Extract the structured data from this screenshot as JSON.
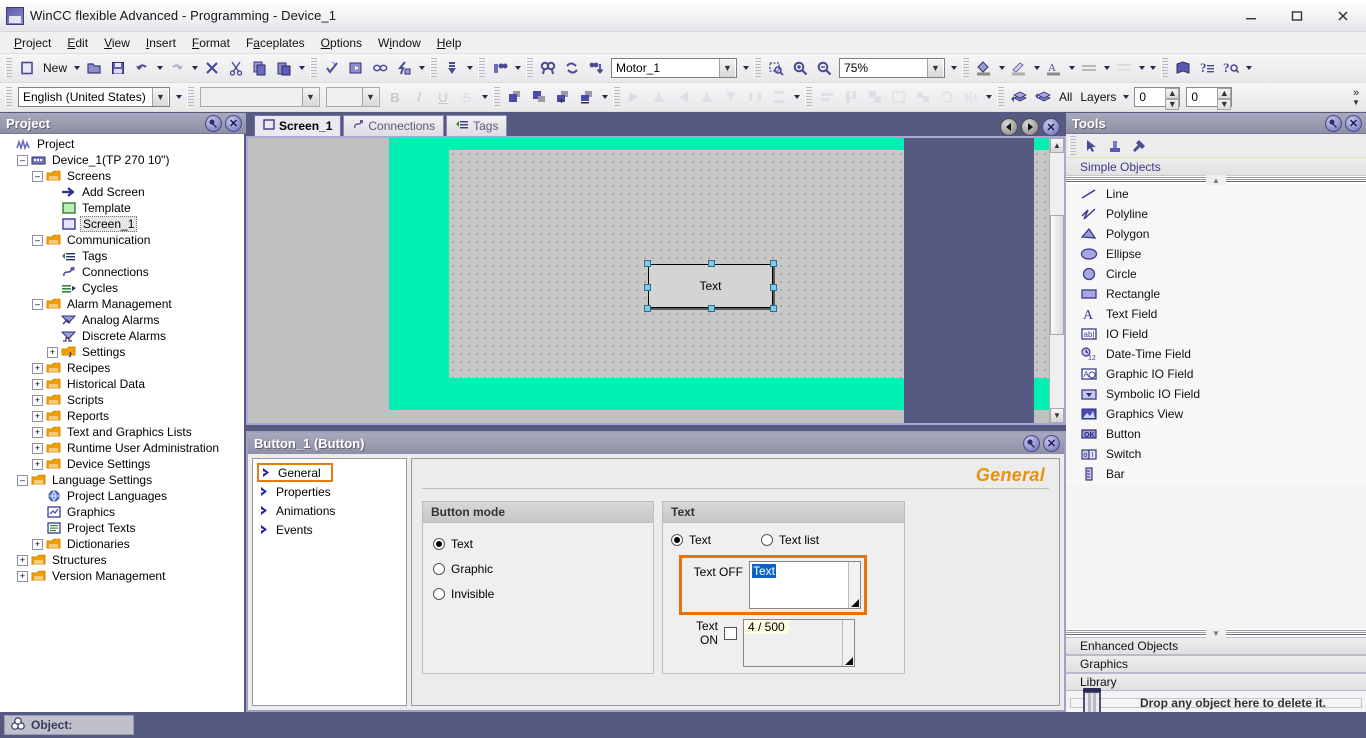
{
  "window": {
    "title": "WinCC flexible Advanced - Programming - Device_1",
    "minimize": "minimize-icon",
    "maximize": "maximize-icon",
    "close": "close-icon"
  },
  "menu": {
    "items": [
      "Project",
      "Edit",
      "View",
      "Insert",
      "Format",
      "Faceplates",
      "Options",
      "Window",
      "Help"
    ]
  },
  "toolbar1": {
    "new_label": "New",
    "tag_combo_value": "Motor_1",
    "zoom_value": "75%",
    "buttons": [
      "new-icon",
      "new-dropdown",
      "open-icon",
      "save-icon",
      "undo-icon",
      "undo-dropdown",
      "redo-icon",
      "redo-dropdown",
      "delete-icon",
      "cut-icon",
      "copy-icon",
      "paste-icon",
      "paste-dropdown",
      "check-consistency-icon",
      "generate-icon",
      "simulate-icon",
      "transfer-icon",
      "transfer-dropdown",
      "download-icon",
      "download-dropdown",
      "compare-icon",
      "compare-dropdown",
      "find-icon",
      "refresh-icon",
      "sort-icon",
      "fill-color-icon",
      "line-color-icon",
      "font-color-icon",
      "line-style-icon",
      "fill-style-icon",
      "help-book-icon",
      "help-topic-icon",
      "help-search-icon"
    ]
  },
  "toolbar2": {
    "language_value": "English (United States)",
    "font_value": "",
    "font_size_value": "",
    "bold_label": "B",
    "italic_label": "I",
    "underline_label": "U",
    "strikethrough_label": "S",
    "layers_all_label": "All",
    "layers_label": "Layers",
    "layer_value_1": "0",
    "layer_value_2": "0",
    "overflow_label": "»"
  },
  "project_panel": {
    "title": "Project",
    "pin_icon": "pin-icon",
    "close_icon": "close-icon",
    "tree": [
      {
        "label": "Project",
        "depth": 0,
        "expander": "",
        "icon": "project-icon"
      },
      {
        "label": "Device_1(TP 270 10\")",
        "depth": 1,
        "expander": "-",
        "icon": "device-icon"
      },
      {
        "label": "Screens",
        "depth": 2,
        "expander": "-",
        "icon": "folder-screens-icon"
      },
      {
        "label": "Add Screen",
        "depth": 3,
        "expander": "",
        "icon": "add-screen-icon"
      },
      {
        "label": "Template",
        "depth": 3,
        "expander": "",
        "icon": "template-icon"
      },
      {
        "label": "Screen_1",
        "depth": 3,
        "expander": "",
        "icon": "screen-icon",
        "selected": true
      },
      {
        "label": "Communication",
        "depth": 2,
        "expander": "-",
        "icon": "folder-comm-icon"
      },
      {
        "label": "Tags",
        "depth": 3,
        "expander": "",
        "icon": "tags-icon"
      },
      {
        "label": "Connections",
        "depth": 3,
        "expander": "",
        "icon": "connections-icon"
      },
      {
        "label": "Cycles",
        "depth": 3,
        "expander": "",
        "icon": "cycles-icon"
      },
      {
        "label": "Alarm Management",
        "depth": 2,
        "expander": "-",
        "icon": "folder-alarm-icon"
      },
      {
        "label": "Analog Alarms",
        "depth": 3,
        "expander": "",
        "icon": "analog-alarms-icon"
      },
      {
        "label": "Discrete Alarms",
        "depth": 3,
        "expander": "",
        "icon": "discrete-alarms-icon"
      },
      {
        "label": "Settings",
        "depth": 3,
        "expander": "+",
        "icon": "settings-icon"
      },
      {
        "label": "Recipes",
        "depth": 2,
        "expander": "+",
        "icon": "folder-recipes-icon"
      },
      {
        "label": "Historical Data",
        "depth": 2,
        "expander": "+",
        "icon": "folder-history-icon"
      },
      {
        "label": "Scripts",
        "depth": 2,
        "expander": "+",
        "icon": "folder-scripts-icon"
      },
      {
        "label": "Reports",
        "depth": 2,
        "expander": "+",
        "icon": "folder-reports-icon"
      },
      {
        "label": "Text and Graphics Lists",
        "depth": 2,
        "expander": "+",
        "icon": "folder-textlists-icon"
      },
      {
        "label": "Runtime User Administration",
        "depth": 2,
        "expander": "+",
        "icon": "folder-users-icon"
      },
      {
        "label": "Device Settings",
        "depth": 2,
        "expander": "+",
        "icon": "folder-devsettings-icon"
      },
      {
        "label": "Language Settings",
        "depth": 1,
        "expander": "-",
        "icon": "folder-lang-icon"
      },
      {
        "label": "Project Languages",
        "depth": 2,
        "expander": "",
        "icon": "globe-icon"
      },
      {
        "label": "Graphics",
        "depth": 2,
        "expander": "",
        "icon": "graphics-icon"
      },
      {
        "label": "Project Texts",
        "depth": 2,
        "expander": "",
        "icon": "texts-icon"
      },
      {
        "label": "Dictionaries",
        "depth": 2,
        "expander": "+",
        "icon": "folder-dict-icon"
      },
      {
        "label": "Structures",
        "depth": 1,
        "expander": "+",
        "icon": "folder-struct-icon"
      },
      {
        "label": "Version Management",
        "depth": 1,
        "expander": "+",
        "icon": "folder-version-icon"
      }
    ]
  },
  "editor": {
    "tabs": [
      {
        "label": "Screen_1",
        "icon": "screen-icon",
        "active": true
      },
      {
        "label": "Connections",
        "icon": "connections-icon",
        "active": false
      },
      {
        "label": "Tags",
        "icon": "tags-icon",
        "active": false
      }
    ],
    "nav_prev": "prev-icon",
    "nav_next": "next-icon",
    "nav_close": "close-icon",
    "object_text": "Text",
    "hmi_background_color": "#00f0b4",
    "grid_color": "#c8c8c8",
    "handle_color": "#7ecbe8"
  },
  "properties": {
    "title": "Button_1 (Button)",
    "pin_icon": "pin-icon",
    "close_icon": "close-icon",
    "section_header": "General",
    "nav": [
      {
        "label": "General",
        "active": true
      },
      {
        "label": "Properties",
        "active": false
      },
      {
        "label": "Animations",
        "active": false
      },
      {
        "label": "Events",
        "active": false
      }
    ],
    "button_mode": {
      "group_title": "Button mode",
      "options": [
        {
          "label": "Text",
          "selected": true
        },
        {
          "label": "Graphic",
          "selected": false
        },
        {
          "label": "Invisible",
          "selected": false
        }
      ]
    },
    "text_group": {
      "group_title": "Text",
      "mode_text_label": "Text",
      "mode_textlist_label": "Text list",
      "mode_selected": "Text",
      "text_off_label": "Text OFF",
      "text_off_value": "Text",
      "text_on_label": "Text ON",
      "text_on_checked": false,
      "text_on_hint": "4 / 500"
    },
    "highlight_color": "#e8710a"
  },
  "tools_panel": {
    "title": "Tools",
    "pin_icon": "pin-icon",
    "close_icon": "close-icon",
    "toolbar_icons": [
      "select-arrow-icon",
      "stamp-icon",
      "settings-tools-icon"
    ],
    "category_label": "Simple Objects",
    "objects": [
      {
        "label": "Line",
        "icon": "line-icon"
      },
      {
        "label": "Polyline",
        "icon": "polyline-icon"
      },
      {
        "label": "Polygon",
        "icon": "polygon-icon"
      },
      {
        "label": "Ellipse",
        "icon": "ellipse-icon"
      },
      {
        "label": "Circle",
        "icon": "circle-icon"
      },
      {
        "label": "Rectangle",
        "icon": "rectangle-icon"
      },
      {
        "label": "Text Field",
        "icon": "text-field-icon"
      },
      {
        "label": "IO Field",
        "icon": "io-field-icon"
      },
      {
        "label": "Date-Time Field",
        "icon": "date-time-field-icon"
      },
      {
        "label": "Graphic IO Field",
        "icon": "graphic-io-field-icon"
      },
      {
        "label": "Symbolic IO Field",
        "icon": "symbolic-io-field-icon"
      },
      {
        "label": "Graphics View",
        "icon": "graphics-view-icon"
      },
      {
        "label": "Button",
        "icon": "button-icon"
      },
      {
        "label": "Switch",
        "icon": "switch-icon"
      },
      {
        "label": "Bar",
        "icon": "bar-icon"
      }
    ],
    "categories": [
      "Enhanced Objects",
      "Graphics",
      "Library"
    ],
    "trash_label": "Drop any object here to delete it.",
    "trash_icon": "trash-icon"
  },
  "statusbar": {
    "object_label": "Object:",
    "object_icon": "object-icon"
  }
}
